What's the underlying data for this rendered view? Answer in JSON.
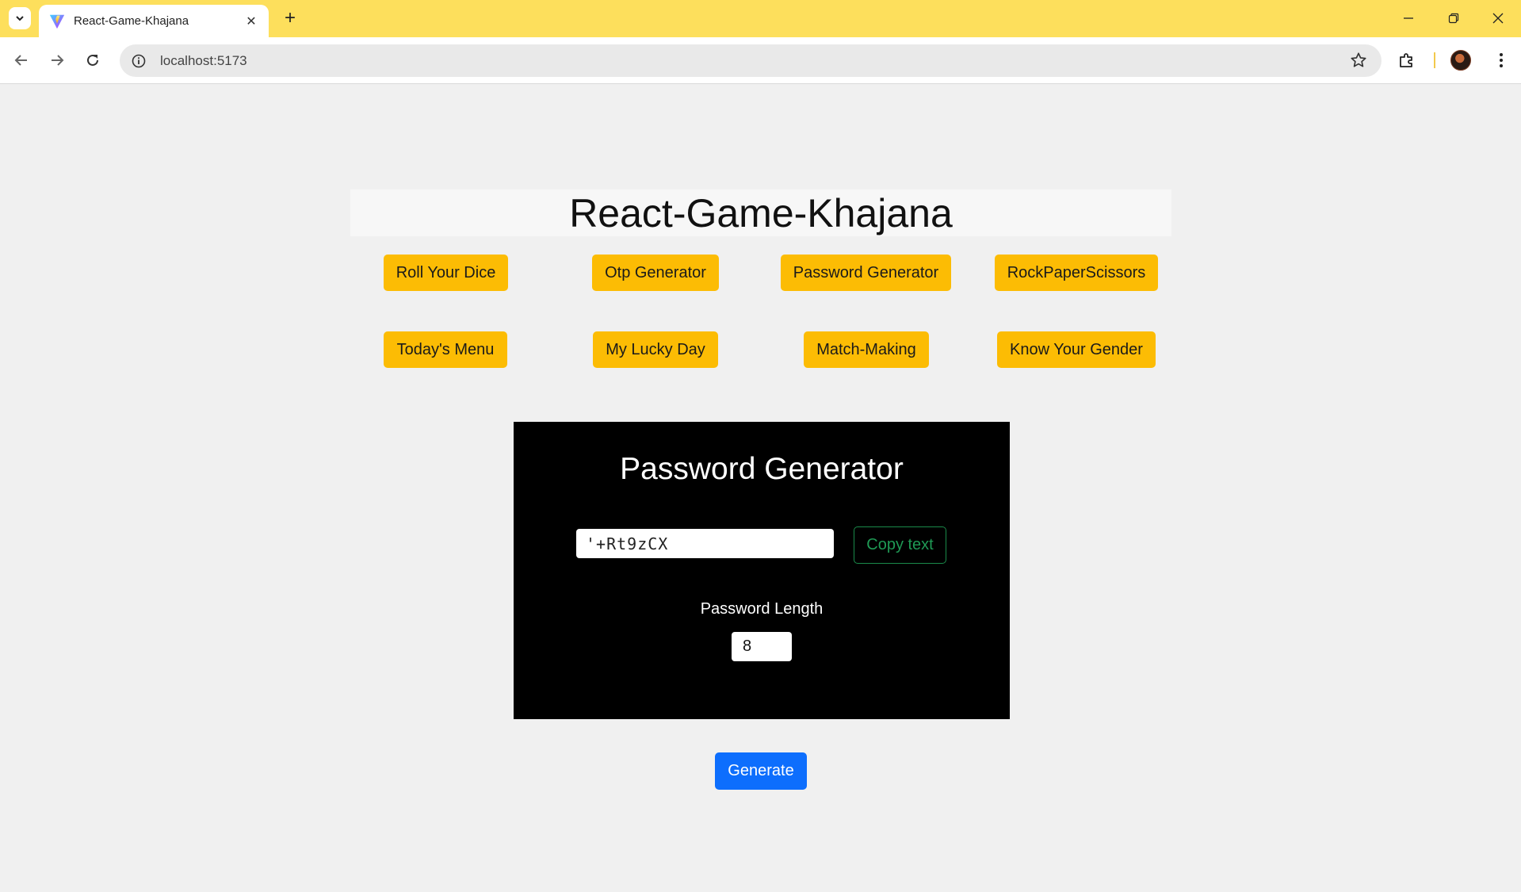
{
  "browser": {
    "tab_title": "React-Game-Khajana",
    "url": "localhost:5173"
  },
  "app": {
    "title": "React-Game-Khajana",
    "games": [
      {
        "label": "Roll Your Dice"
      },
      {
        "label": "Otp Generator"
      },
      {
        "label": "Password Generator"
      },
      {
        "label": "RockPaperScissors"
      },
      {
        "label": "Today's Menu"
      },
      {
        "label": "My Lucky Day"
      },
      {
        "label": "Match-Making"
      },
      {
        "label": "Know Your Gender"
      }
    ]
  },
  "password_generator": {
    "title": "Password Generator",
    "password": "'+Rt9zCX",
    "copy_label": "Copy text",
    "length_label": "Password Length",
    "length_value": "8",
    "generate_label": "Generate"
  },
  "colors": {
    "titlebar": "#fddf5c",
    "game_button": "#fcbc04",
    "generate_button": "#0d6efd",
    "copy_border": "#1a8a4a",
    "card_bg": "#000000"
  }
}
